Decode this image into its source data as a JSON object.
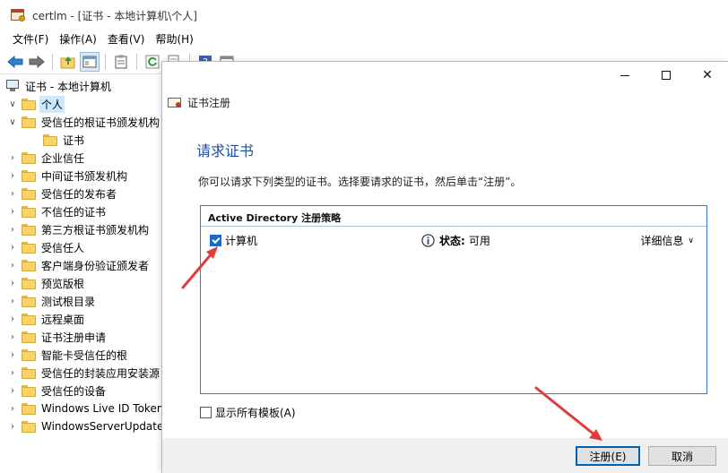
{
  "window": {
    "title": "certlm - [证书 - 本地计算机\\个人]"
  },
  "menu": [
    {
      "label": "文件(F)"
    },
    {
      "label": "操作(A)"
    },
    {
      "label": "查看(V)"
    },
    {
      "label": "帮助(H)"
    }
  ],
  "toolbar": {
    "icons": [
      "back-icon",
      "forward-icon",
      "up-folder-icon",
      "show-tree-icon",
      "clipboard-icon",
      "refresh-icon",
      "export-icon",
      "help-icon",
      "panel-icon"
    ]
  },
  "tree": {
    "root": "证书 - 本地计算机",
    "items": [
      {
        "label": "个人",
        "expanded": true
      },
      {
        "label": "受信任的根证书颁发机构",
        "expanded": true
      },
      {
        "label": "证书",
        "child": true
      },
      {
        "label": "企业信任"
      },
      {
        "label": "中间证书颁发机构"
      },
      {
        "label": "受信任的发布者"
      },
      {
        "label": "不信任的证书"
      },
      {
        "label": "第三方根证书颁发机构"
      },
      {
        "label": "受信任人"
      },
      {
        "label": "客户端身份验证颁发者"
      },
      {
        "label": "预览版根"
      },
      {
        "label": "测试根目录"
      },
      {
        "label": "远程桌面"
      },
      {
        "label": "证书注册申请"
      },
      {
        "label": "智能卡受信任的根"
      },
      {
        "label": "受信任的封装应用安装源"
      },
      {
        "label": "受信任的设备"
      },
      {
        "label": "Windows Live ID Token Issuer"
      },
      {
        "label": "WindowsServerUpdateServices"
      }
    ]
  },
  "dialog": {
    "title": "证书注册",
    "heading": "请求证书",
    "instruction": "你可以请求下列类型的证书。选择要请求的证书，然后单击“注册”。",
    "policy": {
      "header": "Active Directory 注册策略",
      "item_label": "计算机",
      "item_checked": true,
      "status_label": "状态:",
      "status_value": "可用",
      "details": "详细信息"
    },
    "show_all": {
      "label": "显示所有模板(A)",
      "checked": false
    },
    "buttons": {
      "enroll": "注册(E)",
      "cancel": "取消"
    }
  },
  "colors": {
    "accent": "#1f67c4",
    "heading": "#1f4e9c",
    "annotation_arrow": "#e03c3c"
  }
}
